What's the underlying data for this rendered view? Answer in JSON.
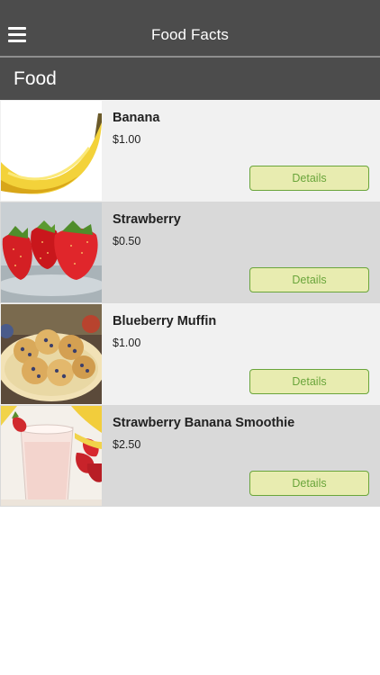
{
  "app": {
    "title": "Food Facts",
    "menu_icon": "hamburger-menu-icon"
  },
  "section": {
    "title": "Food"
  },
  "items": [
    {
      "name": "Banana",
      "price": "$1.00",
      "details_label": "Details",
      "image": "banana-photo"
    },
    {
      "name": "Strawberry",
      "price": "$0.50",
      "details_label": "Details",
      "image": "strawberry-photo"
    },
    {
      "name": "Blueberry Muffin",
      "price": "$1.00",
      "details_label": "Details",
      "image": "blueberry-muffin-photo"
    },
    {
      "name": "Strawberry Banana Smoothie",
      "price": "$2.50",
      "details_label": "Details",
      "image": "smoothie-photo"
    }
  ],
  "colors": {
    "navbar": "#4c4c4c",
    "row_light": "#f1f1f1",
    "row_dark": "#d9d9d9",
    "button_bg": "#e8ecb0",
    "button_border": "#6aa53b"
  }
}
